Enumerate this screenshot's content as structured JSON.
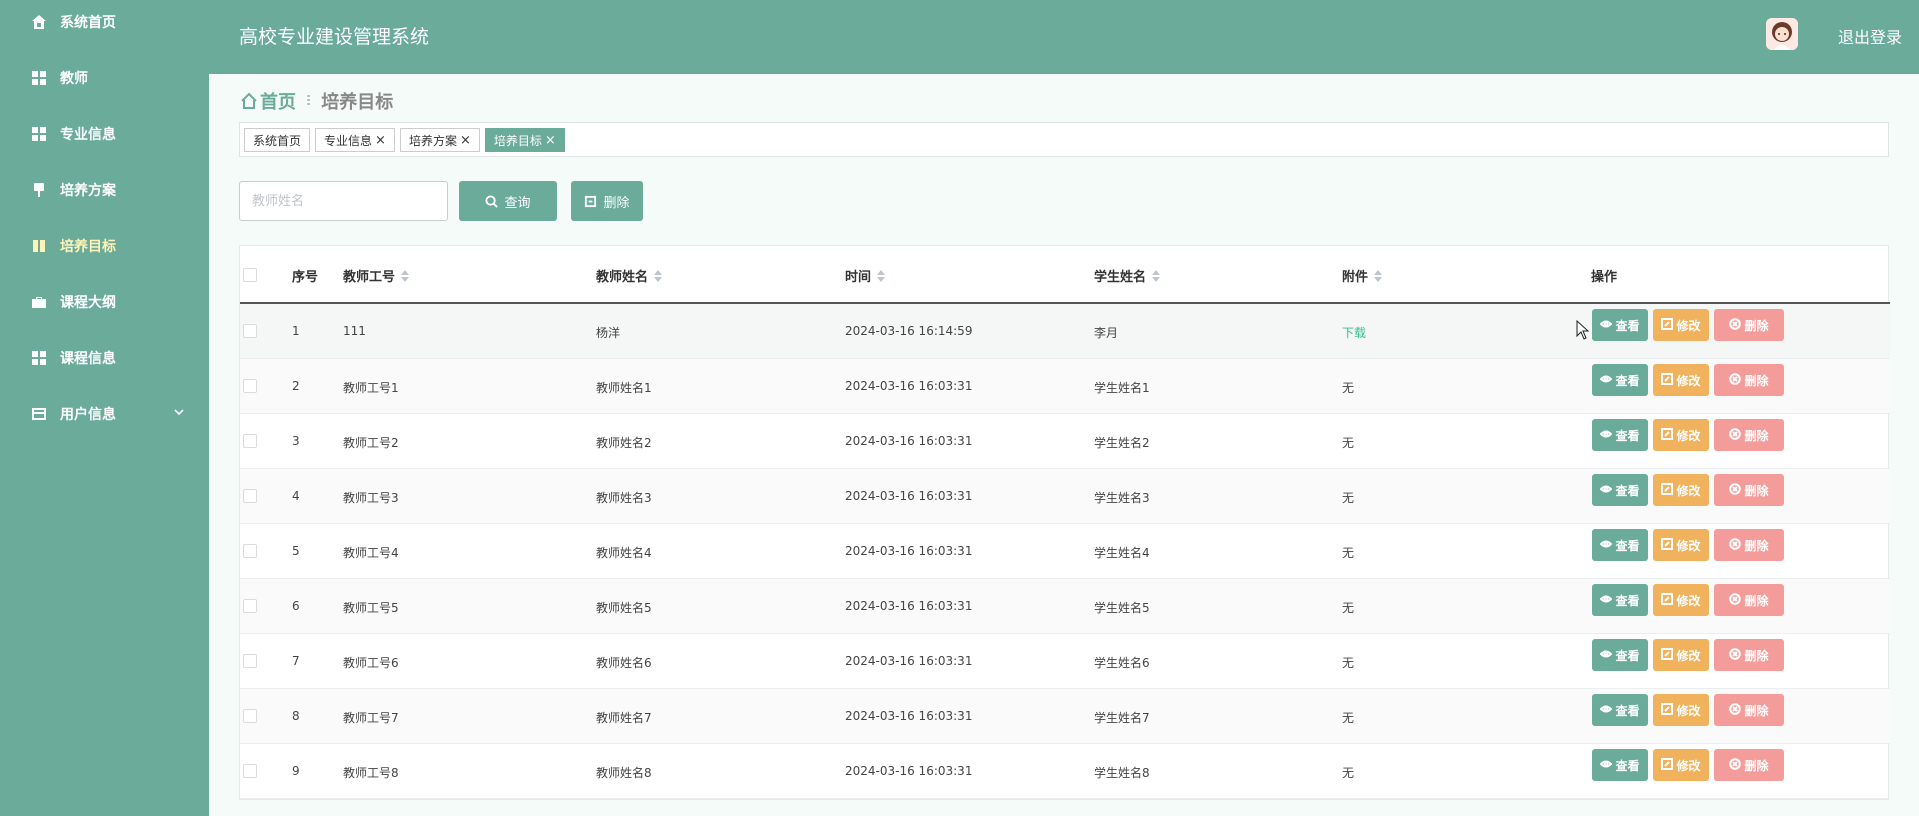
{
  "app": {
    "title": "高校专业建设管理系统",
    "logout": "退出登录"
  },
  "sidebar": {
    "items": [
      {
        "label": "系统首页",
        "icon": "home-icon"
      },
      {
        "label": "教师",
        "icon": "grid-icon"
      },
      {
        "label": "专业信息",
        "icon": "grid-icon"
      },
      {
        "label": "培养方案",
        "icon": "brush-icon"
      },
      {
        "label": "培养目标",
        "icon": "book-icon",
        "active": true
      },
      {
        "label": "课程大纲",
        "icon": "briefcase-icon"
      },
      {
        "label": "课程信息",
        "icon": "grid-icon"
      },
      {
        "label": "用户信息",
        "icon": "card-icon",
        "expandable": true
      }
    ]
  },
  "breadcrumb": {
    "home": "首页",
    "separator": "ⵗ",
    "current": "培养目标"
  },
  "tabs": [
    {
      "label": "系统首页",
      "closable": false
    },
    {
      "label": "专业信息",
      "closable": true
    },
    {
      "label": "培养方案",
      "closable": true
    },
    {
      "label": "培养目标",
      "closable": true,
      "active": true
    }
  ],
  "tab_close_glyph": "×",
  "search": {
    "placeholder": "教师姓名",
    "value": "",
    "query_label": "查询",
    "delete_label": "删除"
  },
  "table": {
    "columns": [
      "序号",
      "教师工号",
      "教师姓名",
      "时间",
      "学生姓名",
      "附件",
      "操作"
    ],
    "actions": {
      "view": "查看",
      "edit": "修改",
      "delete": "删除"
    },
    "rows": [
      {
        "index": "1",
        "teacher_id": "111",
        "teacher_name": "杨洋",
        "time": "2024-03-16 16:14:59",
        "student_name": "李月",
        "attachment": "下载",
        "attachment_link": true
      },
      {
        "index": "2",
        "teacher_id": "教师工号1",
        "teacher_name": "教师姓名1",
        "time": "2024-03-16 16:03:31",
        "student_name": "学生姓名1",
        "attachment": "无"
      },
      {
        "index": "3",
        "teacher_id": "教师工号2",
        "teacher_name": "教师姓名2",
        "time": "2024-03-16 16:03:31",
        "student_name": "学生姓名2",
        "attachment": "无"
      },
      {
        "index": "4",
        "teacher_id": "教师工号3",
        "teacher_name": "教师姓名3",
        "time": "2024-03-16 16:03:31",
        "student_name": "学生姓名3",
        "attachment": "无"
      },
      {
        "index": "5",
        "teacher_id": "教师工号4",
        "teacher_name": "教师姓名4",
        "time": "2024-03-16 16:03:31",
        "student_name": "学生姓名4",
        "attachment": "无"
      },
      {
        "index": "6",
        "teacher_id": "教师工号5",
        "teacher_name": "教师姓名5",
        "time": "2024-03-16 16:03:31",
        "student_name": "学生姓名5",
        "attachment": "无"
      },
      {
        "index": "7",
        "teacher_id": "教师工号6",
        "teacher_name": "教师姓名6",
        "time": "2024-03-16 16:03:31",
        "student_name": "学生姓名6",
        "attachment": "无"
      },
      {
        "index": "8",
        "teacher_id": "教师工号7",
        "teacher_name": "教师姓名7",
        "time": "2024-03-16 16:03:31",
        "student_name": "学生姓名7",
        "attachment": "无"
      },
      {
        "index": "9",
        "teacher_id": "教师工号8",
        "teacher_name": "教师姓名8",
        "time": "2024-03-16 16:03:31",
        "student_name": "学生姓名8",
        "attachment": "无"
      }
    ]
  },
  "colors": {
    "primary": "#6aab99",
    "edit": "#f0b25c",
    "delete": "#f39c9a",
    "link": "#2fbf8a",
    "active_menu": "#fff3b8"
  }
}
